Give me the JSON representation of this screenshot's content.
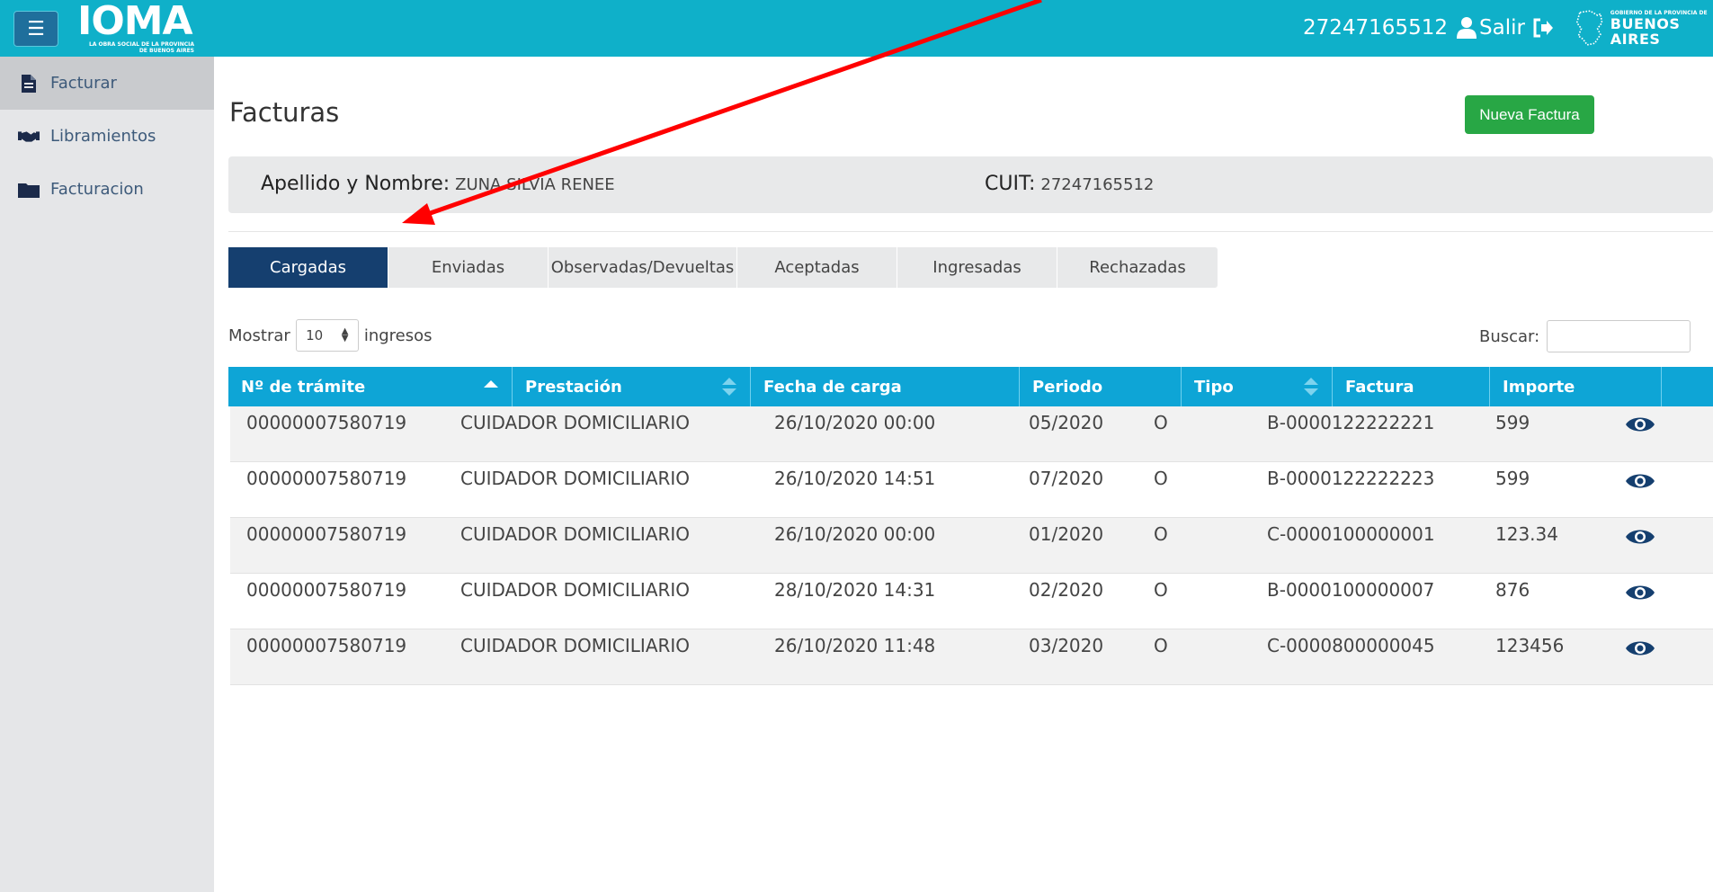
{
  "header": {
    "menu_icon": "hamburger-icon",
    "logo_text": "IOMA",
    "logo_sub_1": "LA OBRA SOCIAL DE LA PROVINCIA",
    "logo_sub_2": "DE BUENOS AIRES",
    "user_id": "27247165512",
    "user_icon": "user-icon",
    "logout_label": "Salir",
    "logout_icon": "sign-out-icon",
    "gov_small": "GOBIERNO DE LA PROVINCIA DE",
    "gov_big": "BUENOS AIRES",
    "bg_color": "#0fb0c9"
  },
  "sidebar": {
    "items": [
      {
        "label": "Facturar",
        "icon": "file-icon",
        "active": true
      },
      {
        "label": "Libramientos",
        "icon": "handshake-icon",
        "active": false
      },
      {
        "label": "Facturacion",
        "icon": "folder-icon",
        "active": false
      }
    ]
  },
  "main": {
    "title": "Facturas",
    "new_button": "Nueva Factura",
    "info": {
      "name_label": "Apellido y Nombre:",
      "name_value": "ZUNA SILVIA RENEE",
      "cuit_label": "CUIT:",
      "cuit_value": "27247165512"
    },
    "tabs": [
      {
        "label": "Cargadas",
        "active": true
      },
      {
        "label": "Enviadas",
        "active": false
      },
      {
        "label": "Observadas/Devueltas",
        "active": false
      },
      {
        "label": "Aceptadas",
        "active": false
      },
      {
        "label": "Ingresadas",
        "active": false
      },
      {
        "label": "Rechazadas",
        "active": false
      }
    ],
    "show_label": "Mostrar",
    "show_value": "10",
    "show_suffix": "ingresos",
    "search_label": "Buscar:",
    "search_value": "",
    "table": {
      "columns": [
        "Nº de trámite",
        "Prestación",
        "Fecha de carga",
        "Periodo",
        "Tipo",
        "Factura",
        "Importe",
        ""
      ],
      "rows": [
        [
          "00000007580719",
          "CUIDADOR DOMICILIARIO",
          "26/10/2020 00:00",
          "05/2020",
          "O",
          "B-0000122222221",
          "599"
        ],
        [
          "00000007580719",
          "CUIDADOR DOMICILIARIO",
          "26/10/2020 14:51",
          "07/2020",
          "O",
          "B-0000122222223",
          "599"
        ],
        [
          "00000007580719",
          "CUIDADOR DOMICILIARIO",
          "26/10/2020 00:00",
          "01/2020",
          "O",
          "C-0000100000001",
          "123.34"
        ],
        [
          "00000007580719",
          "CUIDADOR DOMICILIARIO",
          "28/10/2020 14:31",
          "02/2020",
          "O",
          "B-0000100000007",
          "876"
        ],
        [
          "00000007580719",
          "CUIDADOR DOMICILIARIO",
          "26/10/2020 11:48",
          "03/2020",
          "O",
          "C-0000800000045",
          "123456"
        ]
      ],
      "row_action_icon": "eye-icon",
      "header_color": "#0ea5d6"
    }
  },
  "colors": {
    "tab_active": "#153f6f",
    "new_button": "#28a745",
    "annotation_arrow": "#ff0000"
  }
}
